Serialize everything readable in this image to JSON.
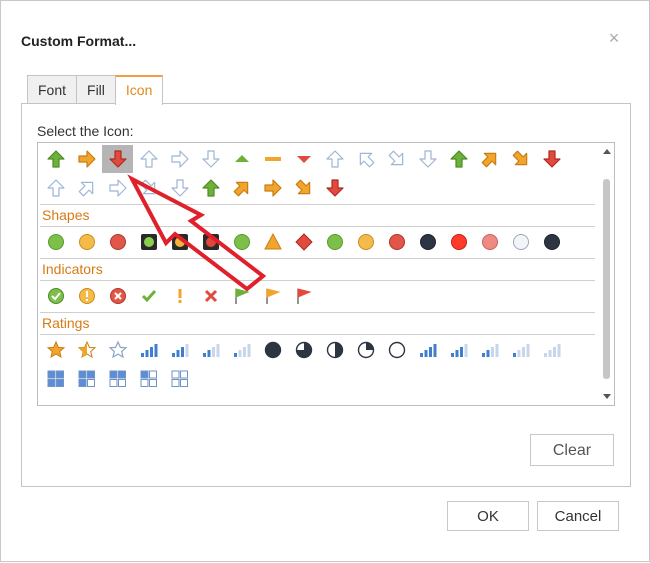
{
  "dialog": {
    "title": "Custom Format...",
    "close_glyph": "×"
  },
  "tabs": [
    {
      "label": "Font",
      "active": false
    },
    {
      "label": "Fill",
      "active": false
    },
    {
      "label": "Icon",
      "active": true
    }
  ],
  "icon_panel": {
    "select_label": "Select the Icon:",
    "groups": [
      {
        "title": "",
        "rows": [
          [
            "arrow-up-green",
            "arrow-right-orange",
            "arrow-down-red",
            "arrow-up-outline",
            "arrow-right-outline",
            "arrow-down-outline",
            "triangle-up-green",
            "dash-yellow",
            "triangle-down-red",
            "arrow-up-outline",
            "arrow-upleft-outline",
            "arrow-downright-outline",
            "arrow-down-outline",
            "arrow-up-green",
            "arrow-upright-orange",
            "arrow-downright-orange",
            "arrow-down-red"
          ],
          [
            "arrow-up-outline",
            "arrow-upright-outline",
            "arrow-right-outline",
            "arrow-downright-outline",
            "arrow-down-outline",
            "arrow-up-green",
            "arrow-upright-orange",
            "arrow-right-orange",
            "arrow-downright-orange",
            "arrow-down-red"
          ]
        ]
      },
      {
        "title": "Shapes",
        "rows": [
          [
            "circle-green",
            "circle-yellow",
            "circle-red",
            "square-green",
            "square-yellow",
            "square-red",
            "circle-green",
            "triangle-yellow",
            "diamond-red",
            "circle-green",
            "circle-yellow",
            "circle-red",
            "circle-black",
            "circle-brightred",
            "circle-pink",
            "circle-white",
            "circle-black"
          ]
        ]
      },
      {
        "title": "Indicators",
        "rows": [
          [
            "check-circle-green",
            "exclaim-circle-yellow",
            "x-circle-red",
            "check-green",
            "exclaim-yellow",
            "x-red",
            "flag-green",
            "flag-yellow",
            "flag-red"
          ]
        ]
      },
      {
        "title": "Ratings",
        "rows": [
          [
            "star-full",
            "star-half",
            "star-empty",
            "bars-4",
            "bars-3",
            "bars-2",
            "bars-1",
            "pie-full",
            "pie-3q",
            "pie-half",
            "pie-1q",
            "pie-empty",
            "bars-4",
            "bars-3",
            "bars-2",
            "bars-1",
            "bars-0"
          ],
          [
            "boxes-4",
            "boxes-3",
            "boxes-2",
            "boxes-1",
            "boxes-0"
          ]
        ]
      }
    ],
    "selected_icon": "arrow-down-red"
  },
  "buttons": {
    "clear": "Clear",
    "ok": "OK",
    "cancel": "Cancel"
  },
  "colors": {
    "accent": "#e08a1e",
    "green": "#6cb23a",
    "orange": "#f2a52c",
    "red": "#e04a3f",
    "outline": "#9eb5d6",
    "annotation": "#e0202a"
  }
}
